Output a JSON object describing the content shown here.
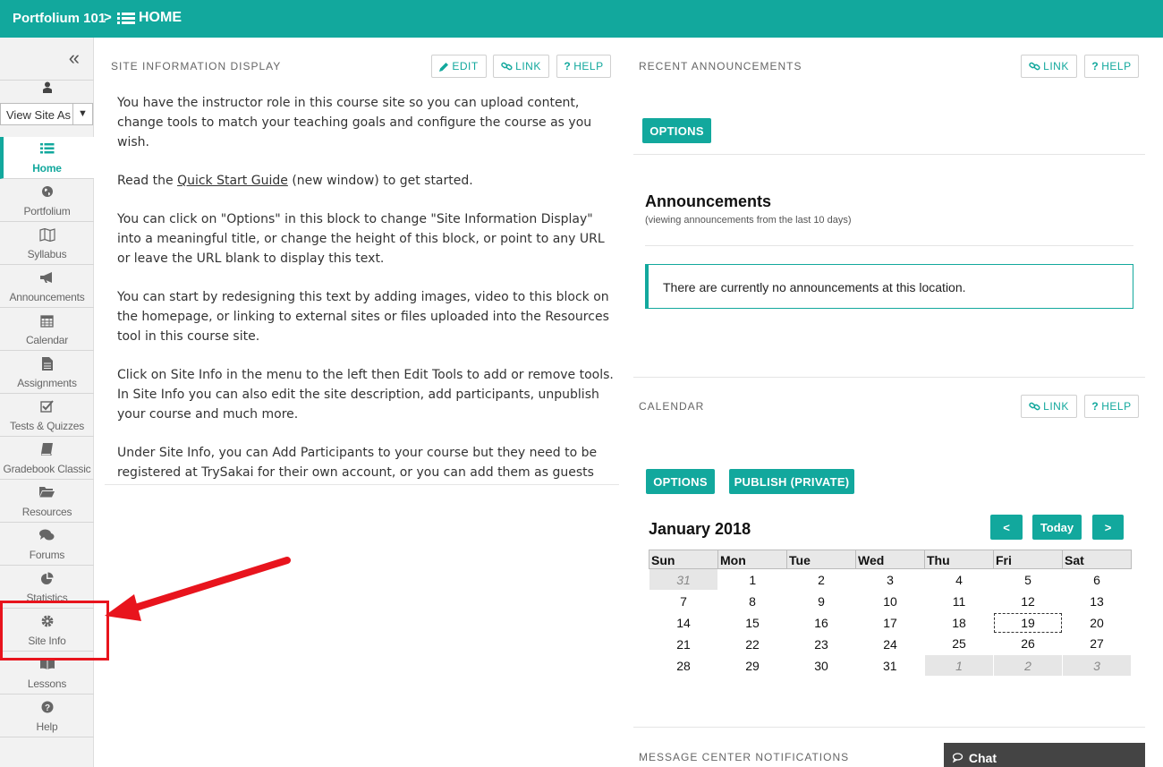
{
  "topbar": {
    "site": "Portfolium 101",
    "separator": ">",
    "page": "HOME"
  },
  "sidebar": {
    "collapse_glyph": "«",
    "view_as": "View Site As",
    "items": [
      {
        "label": "Home",
        "icon": "list-icon",
        "active": true
      },
      {
        "label": "Portfolium",
        "icon": "globe-icon"
      },
      {
        "label": "Syllabus",
        "icon": "map-icon"
      },
      {
        "label": "Announcements",
        "icon": "bullhorn-icon"
      },
      {
        "label": "Calendar",
        "icon": "calendar-icon"
      },
      {
        "label": "Assignments",
        "icon": "file-icon"
      },
      {
        "label": "Tests & Quizzes",
        "icon": "checkbox-icon"
      },
      {
        "label": "Gradebook Classic",
        "icon": "book-icon"
      },
      {
        "label": "Resources",
        "icon": "folder-icon"
      },
      {
        "label": "Forums",
        "icon": "comments-icon"
      },
      {
        "label": "Statistics",
        "icon": "pie-chart-icon"
      },
      {
        "label": "Site Info",
        "icon": "gear-icon"
      },
      {
        "label": "Lessons",
        "icon": "book-open-icon"
      },
      {
        "label": "Help",
        "icon": "question-icon"
      }
    ]
  },
  "site_info": {
    "title": "SITE INFORMATION DISPLAY",
    "edit": "EDIT",
    "link": "LINK",
    "help": "HELP",
    "p1": "You have the instructor role in this course site so you can upload content, change tools to match your teaching goals and configure the course as you wish.",
    "p2_before": "Read the ",
    "p2_link": "Quick Start Guide",
    "p2_after": " (new window) to get started.",
    "p3": "You can click on \"Options\" in this block to change \"Site Information Display\" into a meaningful title, or change the height of this block, or point to any URL or leave the URL blank to display this text.",
    "p4": "You can start by redesigning this text by adding images, video to this block on the homepage, or linking to external sites or files uploaded into the Resources tool in this course site.",
    "p5": "Click on Site Info in the menu to the left then Edit Tools to add or remove tools.  In Site Info you can also edit the site description, add participants, unpublish your course and much more.",
    "p6": "Under Site Info, you can Add Participants to your course but they need to be registered at TrySakai for their own account, or you can add them as guests"
  },
  "announcements": {
    "section_title": "RECENT ANNOUNCEMENTS",
    "link": "LINK",
    "help": "HELP",
    "options": "OPTIONS",
    "title": "Announcements",
    "subtitle": "(viewing announcements from the last 10 days)",
    "empty": "There are currently no announcements at this location."
  },
  "calendar": {
    "section_title": "CALENDAR",
    "link": "LINK",
    "help": "HELP",
    "options": "OPTIONS",
    "publish": "PUBLISH (PRIVATE)",
    "month": "January 2018",
    "prev": "<",
    "today": "Today",
    "next": ">",
    "days": [
      "Sun",
      "Mon",
      "Tue",
      "Wed",
      "Thu",
      "Fri",
      "Sat"
    ],
    "weeks": [
      [
        "31",
        "1",
        "2",
        "3",
        "4",
        "5",
        "6"
      ],
      [
        "7",
        "8",
        "9",
        "10",
        "11",
        "12",
        "13"
      ],
      [
        "14",
        "15",
        "16",
        "17",
        "18",
        "19",
        "20"
      ],
      [
        "21",
        "22",
        "23",
        "24",
        "25",
        "26",
        "27"
      ],
      [
        "28",
        "29",
        "30",
        "31",
        "1",
        "2",
        "3"
      ]
    ]
  },
  "message_center": {
    "section_title": "MESSAGE CENTER NOTIFICATIONS"
  },
  "chat": {
    "label": "Chat"
  },
  "colors": {
    "accent": "#12a89d",
    "highlight": "#e8141d"
  }
}
